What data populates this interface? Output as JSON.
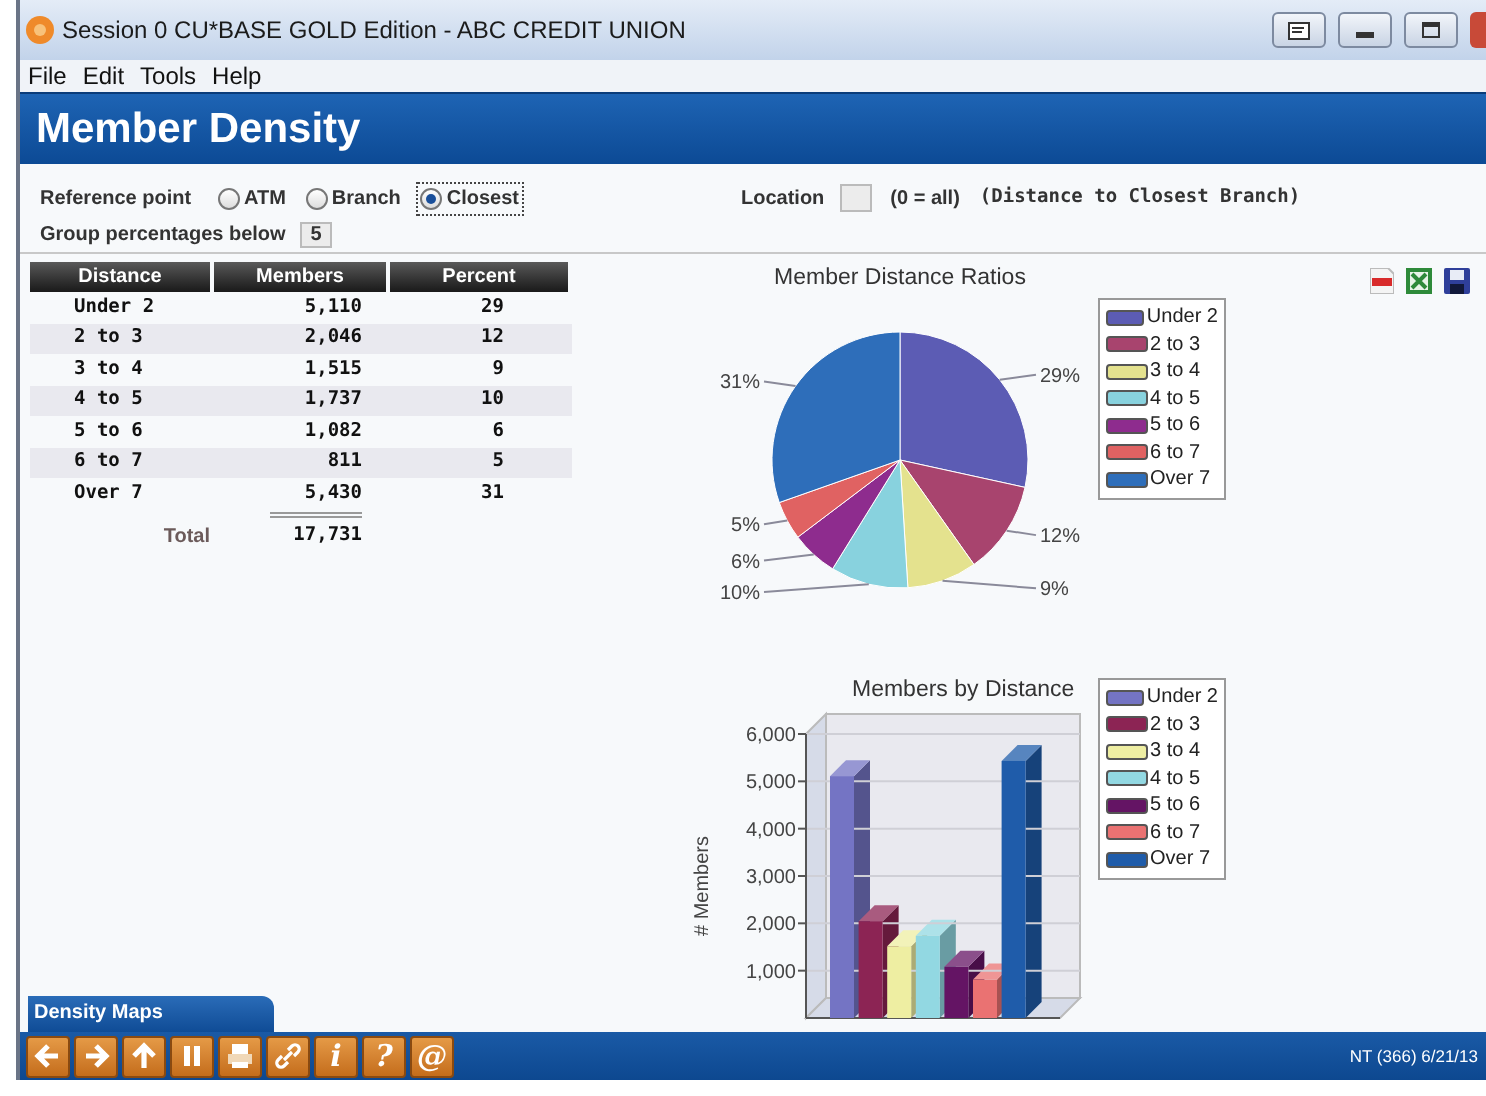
{
  "window": {
    "title": "Session 0 CU*BASE GOLD Edition - ABC CREDIT UNION"
  },
  "menu": [
    "File",
    "Edit",
    "Tools",
    "Help"
  ],
  "header": {
    "title": "Member Density"
  },
  "form": {
    "reference_label": "Reference point",
    "options": [
      {
        "label": "ATM",
        "selected": false,
        "focused": false
      },
      {
        "label": "Branch",
        "selected": false,
        "focused": false
      },
      {
        "label": "Closest",
        "selected": true,
        "focused": true
      }
    ],
    "location_label": "Location",
    "location_hint": "(0 = all)",
    "location_note": "(Distance to Closest Branch)",
    "group_label": "Group percentages below",
    "group_value": "5"
  },
  "table": {
    "columns": [
      "Distance",
      "Members",
      "Percent"
    ],
    "rows": [
      {
        "distance": "Under 2",
        "members": "5,110",
        "percent": "29"
      },
      {
        "distance": "2 to 3",
        "members": "2,046",
        "percent": "12"
      },
      {
        "distance": "3 to 4",
        "members": "1,515",
        "percent": "9"
      },
      {
        "distance": "4 to 5",
        "members": "1,737",
        "percent": "10"
      },
      {
        "distance": "5 to 6",
        "members": "1,082",
        "percent": "6"
      },
      {
        "distance": "6 to 7",
        "members": "811",
        "percent": "5"
      },
      {
        "distance": "Over 7",
        "members": "5,430",
        "percent": "31"
      }
    ],
    "total_label": "Total",
    "total_value": "17,731"
  },
  "pie": {
    "chart_data": {
      "type": "pie",
      "title": "Member Distance Ratios",
      "categories": [
        "Under 2",
        "2 to 3",
        "3 to 4",
        "4 to 5",
        "5 to 6",
        "6 to 7",
        "Over 7"
      ],
      "values": [
        29,
        12,
        9,
        10,
        6,
        5,
        31
      ],
      "colors": [
        "#5c5cb4",
        "#a8446e",
        "#e4e28e",
        "#88d2de",
        "#8e2c8e",
        "#e06262",
        "#2e6eba"
      ],
      "value_labels": [
        "29%",
        "12%",
        "9%",
        "10%",
        "6%",
        "5%",
        "31%"
      ]
    }
  },
  "bars": {
    "chart_data": {
      "type": "bar",
      "title": "Members by Distance",
      "ylabel": "# Members",
      "series": [
        {
          "name": "Under 2",
          "color": "#7474c4",
          "values": [
            5110
          ]
        },
        {
          "name": "2 to 3",
          "color": "#8c2454",
          "values": [
            2046
          ]
        },
        {
          "name": "3 to 4",
          "color": "#eeeea2",
          "values": [
            1515
          ]
        },
        {
          "name": "4 to 5",
          "color": "#92d8e2",
          "values": [
            1737
          ]
        },
        {
          "name": "5 to 6",
          "color": "#641464",
          "values": [
            1082
          ]
        },
        {
          "name": "6 to 7",
          "color": "#ea7272",
          "values": [
            811
          ]
        },
        {
          "name": "Over 7",
          "color": "#1f5caa",
          "values": [
            5430
          ]
        }
      ],
      "ylim": [
        0,
        6000
      ],
      "grid": true,
      "yticks": [
        {
          "value": 1000,
          "label": "1,000"
        },
        {
          "value": 2000,
          "label": "2,000"
        },
        {
          "value": 3000,
          "label": "3,000"
        },
        {
          "value": 4000,
          "label": "4,000"
        },
        {
          "value": 5000,
          "label": "5,000"
        },
        {
          "value": 6000,
          "label": "6,000"
        }
      ]
    }
  },
  "bottom_tab": "Density Maps",
  "toolbar": [
    {
      "kind": "back"
    },
    {
      "kind": "forward"
    },
    {
      "kind": "up"
    },
    {
      "kind": "pause"
    },
    {
      "kind": "print"
    },
    {
      "kind": "link"
    },
    {
      "kind": "glyph",
      "text": "i"
    },
    {
      "kind": "glyph",
      "text": "?"
    },
    {
      "kind": "glyph",
      "text": "@"
    }
  ],
  "status": "NT (366) 6/21/13"
}
